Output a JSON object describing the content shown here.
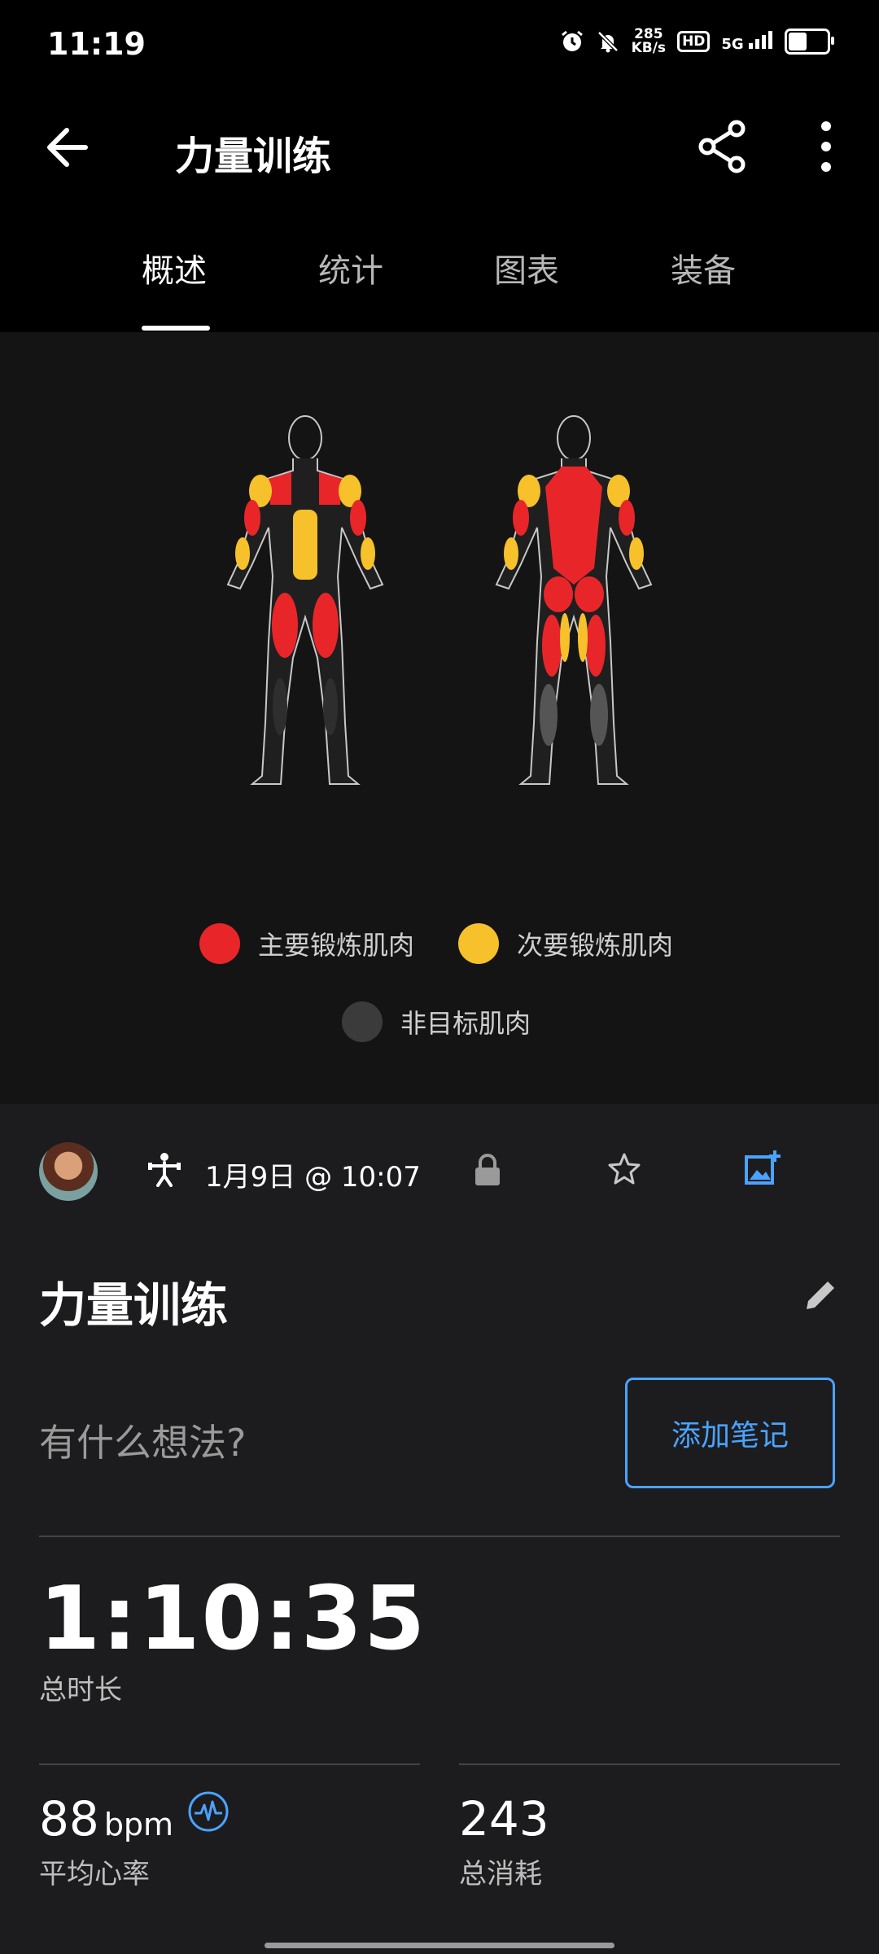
{
  "status_bar": {
    "time": "11:19",
    "net_speed_value": "285",
    "net_speed_unit": "KB/s",
    "hd_label": "HD",
    "network": "5G",
    "icons": [
      "alarm-icon",
      "bell-off-icon",
      "signal-icon",
      "battery-icon"
    ]
  },
  "app_bar": {
    "title": "力量训练",
    "icons": [
      "arrow-left-icon",
      "share-icon",
      "more-vert-icon"
    ]
  },
  "tabs": [
    {
      "label": "概述",
      "active": true
    },
    {
      "label": "统计",
      "active": false
    },
    {
      "label": "图表",
      "active": false
    },
    {
      "label": "装备",
      "active": false
    }
  ],
  "muscle_map": {
    "legend": [
      {
        "label": "主要锻炼肌肉",
        "color": "#e8262a"
      },
      {
        "label": "次要锻炼肌肉",
        "color": "#f6c12a"
      },
      {
        "label": "非目标肌肉",
        "color": "#3b3b3b"
      }
    ]
  },
  "activity": {
    "datetime": "1月9日 @ 10:07",
    "title": "力量训练",
    "note_placeholder": "有什么想法?",
    "add_note_label": "添加笔记",
    "icons": [
      "avatar",
      "strength-training-icon",
      "lock-icon",
      "star-icon",
      "add-photo-icon",
      "pencil-icon",
      "heart-rate-icon"
    ]
  },
  "stats": {
    "duration": "1:10:35",
    "duration_label": "总时长",
    "avg_hr_value": "88",
    "avg_hr_unit": "bpm",
    "avg_hr_label": "平均心率",
    "calories_value": "243",
    "calories_label": "总消耗"
  },
  "colors": {
    "accent": "#4aa3ff",
    "primary_muscle": "#e8262a",
    "secondary_muscle": "#f6c12a",
    "untargeted_muscle": "#3b3b3b"
  }
}
